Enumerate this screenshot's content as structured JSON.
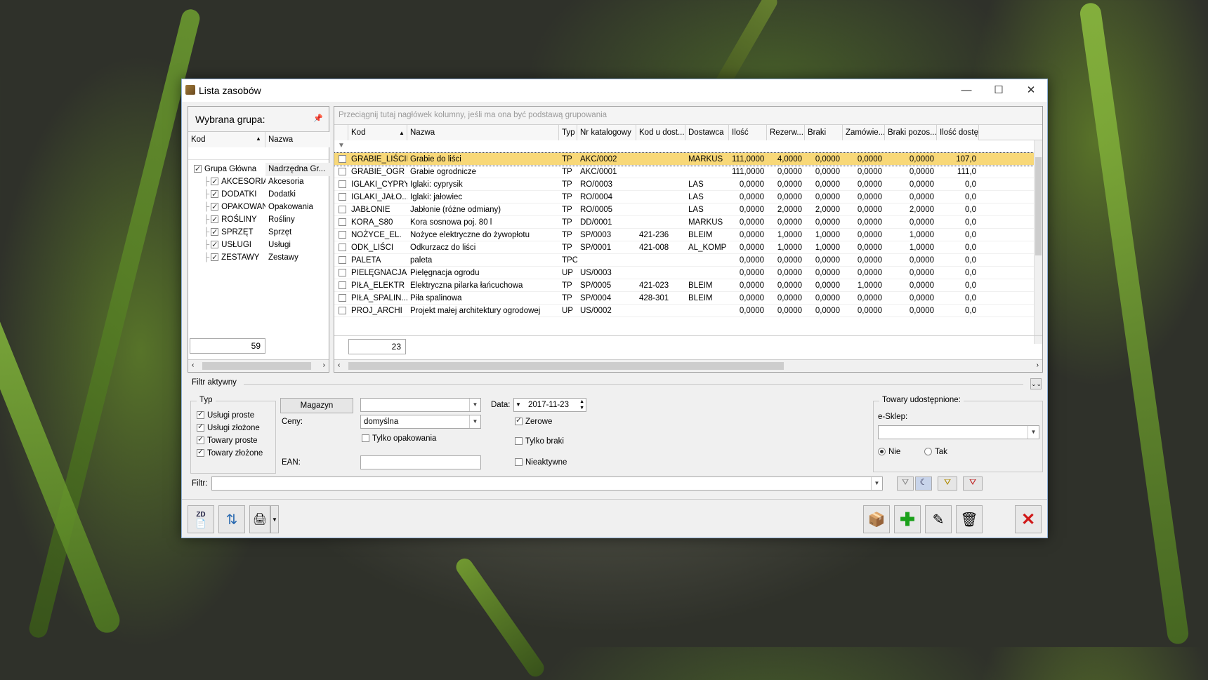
{
  "window": {
    "title": "Lista zasobów"
  },
  "groups_panel": {
    "title": "Wybrana grupa:",
    "pin_icon": "pin-icon",
    "col_kod": "Kod",
    "col_nazwa": "Nazwa",
    "items": [
      {
        "kod": "Grupa Główna",
        "nazwa": "Nadrzędna Gr...",
        "checked": true,
        "root": true
      },
      {
        "kod": "AKCESORIA",
        "nazwa": "Akcesoria",
        "checked": true
      },
      {
        "kod": "DODATKI",
        "nazwa": "Dodatki",
        "checked": true
      },
      {
        "kod": "OPAKOWANIA",
        "nazwa": "Opakowania",
        "checked": true
      },
      {
        "kod": "ROŚLINY",
        "nazwa": "Rośliny",
        "checked": true
      },
      {
        "kod": "SPRZĘT",
        "nazwa": "Sprzęt",
        "checked": true
      },
      {
        "kod": "USŁUGI",
        "nazwa": "Usługi",
        "checked": true
      },
      {
        "kod": "ZESTAWY",
        "nazwa": "Zestawy",
        "checked": true
      }
    ],
    "count": "59"
  },
  "grid": {
    "group_hint": "Przeciągnij tutaj nagłówek kolumny, jeśli ma ona być podstawą grupowania",
    "columns": [
      "Kod",
      "Nazwa",
      "Typ",
      "Nr katalogowy",
      "Kod u dost...",
      "Dostawca",
      "Ilość",
      "Rezerw...",
      "Braki",
      "Zamówie...",
      "Braki pozos...",
      "Ilość dostę..."
    ],
    "rows": [
      [
        "GRABIE_LIŚCIE",
        "Grabie do liści",
        "TP",
        "AKC/0002",
        "",
        "MARKUS",
        "111,0000",
        "4,0000",
        "0,0000",
        "0,0000",
        "0,0000",
        "107,0"
      ],
      [
        "GRABIE_OGR",
        "Grabie ogrodnicze",
        "TP",
        "AKC/0001",
        "",
        "",
        "111,0000",
        "0,0000",
        "0,0000",
        "0,0000",
        "0,0000",
        "111,0"
      ],
      [
        "IGLAKI_CYPRYS",
        "Iglaki: cyprysik",
        "TP",
        "RO/0003",
        "",
        "LAS",
        "0,0000",
        "0,0000",
        "0,0000",
        "0,0000",
        "0,0000",
        "0,0"
      ],
      [
        "IGLAKI_JAŁO...",
        "Iglaki: jałowiec",
        "TP",
        "RO/0004",
        "",
        "LAS",
        "0,0000",
        "0,0000",
        "0,0000",
        "0,0000",
        "0,0000",
        "0,0"
      ],
      [
        "JABŁONIE",
        "Jabłonie (różne odmiany)",
        "TP",
        "RO/0005",
        "",
        "LAS",
        "0,0000",
        "2,0000",
        "2,0000",
        "0,0000",
        "2,0000",
        "0,0"
      ],
      [
        "KORA_S80",
        "Kora sosnowa poj. 80 l",
        "TP",
        "DD/0001",
        "",
        "MARKUS",
        "0,0000",
        "0,0000",
        "0,0000",
        "0,0000",
        "0,0000",
        "0,0"
      ],
      [
        "NOŻYCE_EL.",
        "Nożyce elektryczne do żywopłotu",
        "TP",
        "SP/0003",
        "421-236",
        "BLEIM",
        "0,0000",
        "1,0000",
        "1,0000",
        "0,0000",
        "1,0000",
        "0,0"
      ],
      [
        "ODK_LIŚCI",
        "Odkurzacz do liści",
        "TP",
        "SP/0001",
        "421-008",
        "AL_KOMP",
        "0,0000",
        "1,0000",
        "1,0000",
        "0,0000",
        "1,0000",
        "0,0"
      ],
      [
        "PALETA",
        "paleta",
        "TPO",
        "",
        "",
        "",
        "0,0000",
        "0,0000",
        "0,0000",
        "0,0000",
        "0,0000",
        "0,0"
      ],
      [
        "PIELĘGNACJA",
        "Pielęgnacja ogrodu",
        "UP",
        "US/0003",
        "",
        "",
        "0,0000",
        "0,0000",
        "0,0000",
        "0,0000",
        "0,0000",
        "0,0"
      ],
      [
        "PIŁA_ELEKTR",
        "Elektryczna pilarka łańcuchowa",
        "TP",
        "SP/0005",
        "421-023",
        "BLEIM",
        "0,0000",
        "0,0000",
        "0,0000",
        "1,0000",
        "0,0000",
        "0,0"
      ],
      [
        "PIŁA_SPALIN...",
        "Piła spalinowa",
        "TP",
        "SP/0004",
        "428-301",
        "BLEIM",
        "0,0000",
        "0,0000",
        "0,0000",
        "0,0000",
        "0,0000",
        "0,0"
      ],
      [
        "PROJ_ARCHI",
        "Projekt małej architektury ogrodowej",
        "UP",
        "US/0002",
        "",
        "",
        "0,0000",
        "0,0000",
        "0,0000",
        "0,0000",
        "0,0000",
        "0,0"
      ]
    ],
    "count": "23"
  },
  "filter": {
    "title": "Filtr aktywny",
    "typ_title": "Typ",
    "typ_items": [
      {
        "label": "Usługi proste",
        "checked": true
      },
      {
        "label": "Usługi złożone",
        "checked": true
      },
      {
        "label": "Towary proste",
        "checked": true
      },
      {
        "label": "Towary złożone",
        "checked": true
      }
    ],
    "magazyn_button": "Magazyn",
    "magazyn_value": "",
    "ceny_label": "Ceny:",
    "ceny_value": "domyślna",
    "tylko_opakowania": "Tylko opakowania",
    "ean_label": "EAN:",
    "ean_value": "",
    "data_label": "Data:",
    "data_value": "2017-11-23",
    "zerowe": "Zerowe",
    "tylko_braki": "Tylko braki",
    "nieaktywne": "Nieaktywne",
    "shared_title": "Towary udostępnione:",
    "esklep_label": "e-Sklep:",
    "esklep_value": "",
    "nie_label": "Nie",
    "tak_label": "Tak",
    "filtr_label": "Filtr:",
    "filtr_value": ""
  },
  "toolbar": {
    "zd_label": "ZD"
  }
}
